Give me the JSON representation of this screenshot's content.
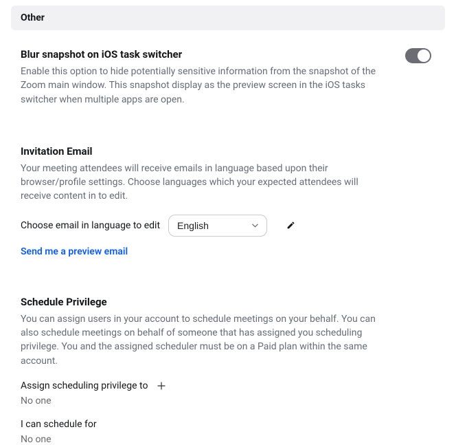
{
  "header": {
    "title": "Other"
  },
  "blur": {
    "title": "Blur snapshot on iOS task switcher",
    "desc": "Enable this option to hide potentially sensitive information from the snapshot of the Zoom main window. This snapshot display as the preview screen in the iOS tasks switcher when multiple apps are open."
  },
  "invitation": {
    "title": "Invitation Email",
    "desc": "Your meeting attendees will receive emails in language based upon their browser/profile settings. Choose languages which your expected attendees will receive content in to edit.",
    "choose_label": "Choose email in language to edit",
    "language": "English",
    "preview_link": "Send me a preview email"
  },
  "schedule": {
    "title": "Schedule Privilege",
    "desc": "You can assign users in your account to schedule meetings on your behalf. You can also schedule meetings on behalf of someone that has assigned you scheduling privilege. You and the assigned scheduler must be on a Paid plan within the same account.",
    "assign_label": "Assign scheduling privilege to",
    "assign_value": "No one",
    "can_schedule_label": "I can schedule for",
    "can_schedule_value": "No one"
  }
}
